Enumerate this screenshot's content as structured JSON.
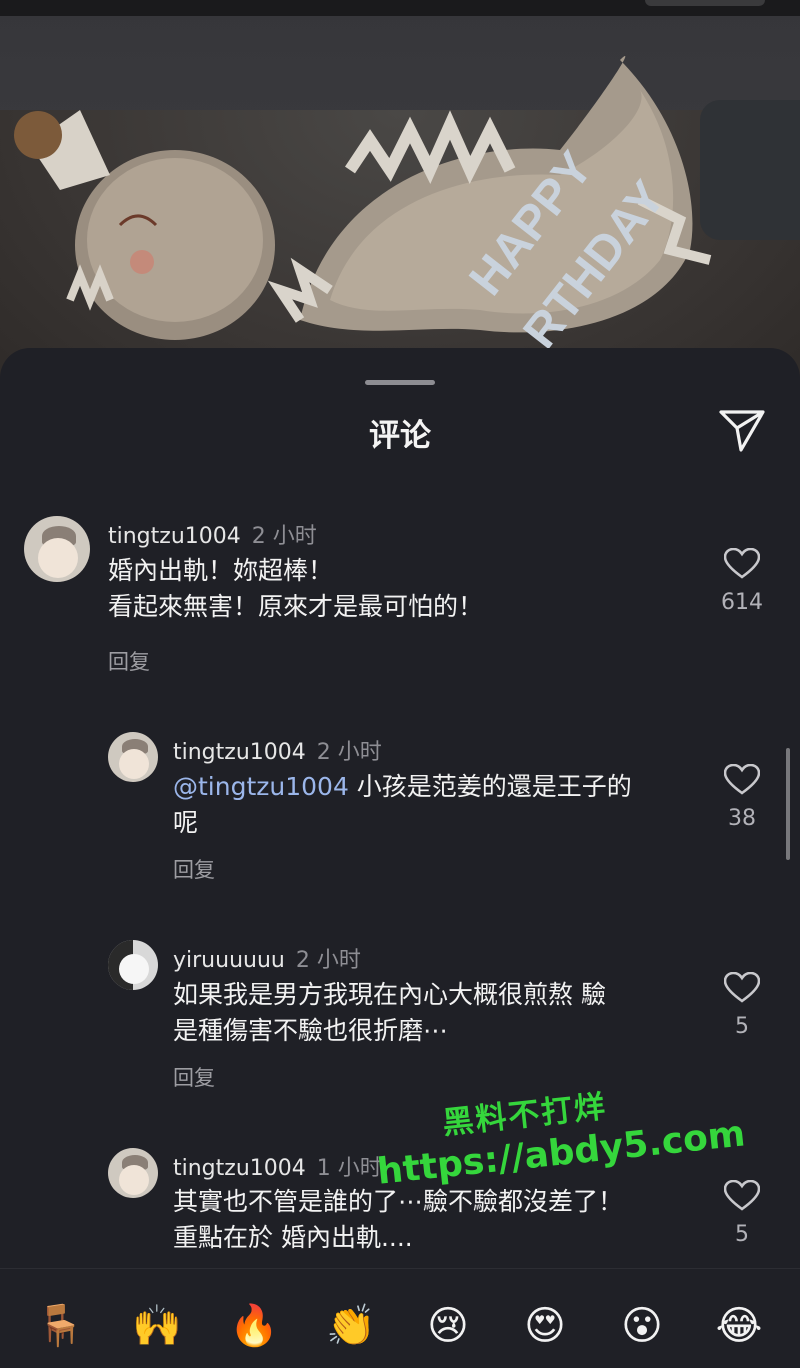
{
  "sheet": {
    "title": "评论"
  },
  "icons": {
    "share": "send-icon",
    "like": "heart-outline-icon"
  },
  "watermark": {
    "line1": "黑料不打烊",
    "line2": "https://abdy5.com"
  },
  "comments": [
    {
      "username": "tingtzu1004",
      "time": "2 小时",
      "lines": [
        "婚內出軌！妳超棒！",
        "看起來無害！原來才是最可怕的！"
      ],
      "reply": "回复",
      "likes": "614"
    },
    {
      "username": "tingtzu1004",
      "time": "2 小时",
      "mention": "@tingtzu1004",
      "lines": [
        " 小孩是范姜的還是王子的",
        "呢"
      ],
      "reply": "回复",
      "likes": "38"
    },
    {
      "username": "yiruuuuuu",
      "time": "2 小时",
      "lines": [
        "如果我是男方我現在內心大概很煎熬 驗",
        "是種傷害不驗也很折磨⋯"
      ],
      "reply": "回复",
      "likes": "5"
    },
    {
      "username": "tingtzu1004",
      "time": "1 小时",
      "lines": [
        "其實也不管是誰的了⋯驗不驗都沒差了！",
        "重點在於 婚內出軌...."
      ],
      "likes": "5"
    }
  ],
  "emoji_bar": [
    "🪑",
    "🙌",
    "🔥",
    "👏",
    "😢",
    "😍",
    "😮",
    "😂"
  ]
}
